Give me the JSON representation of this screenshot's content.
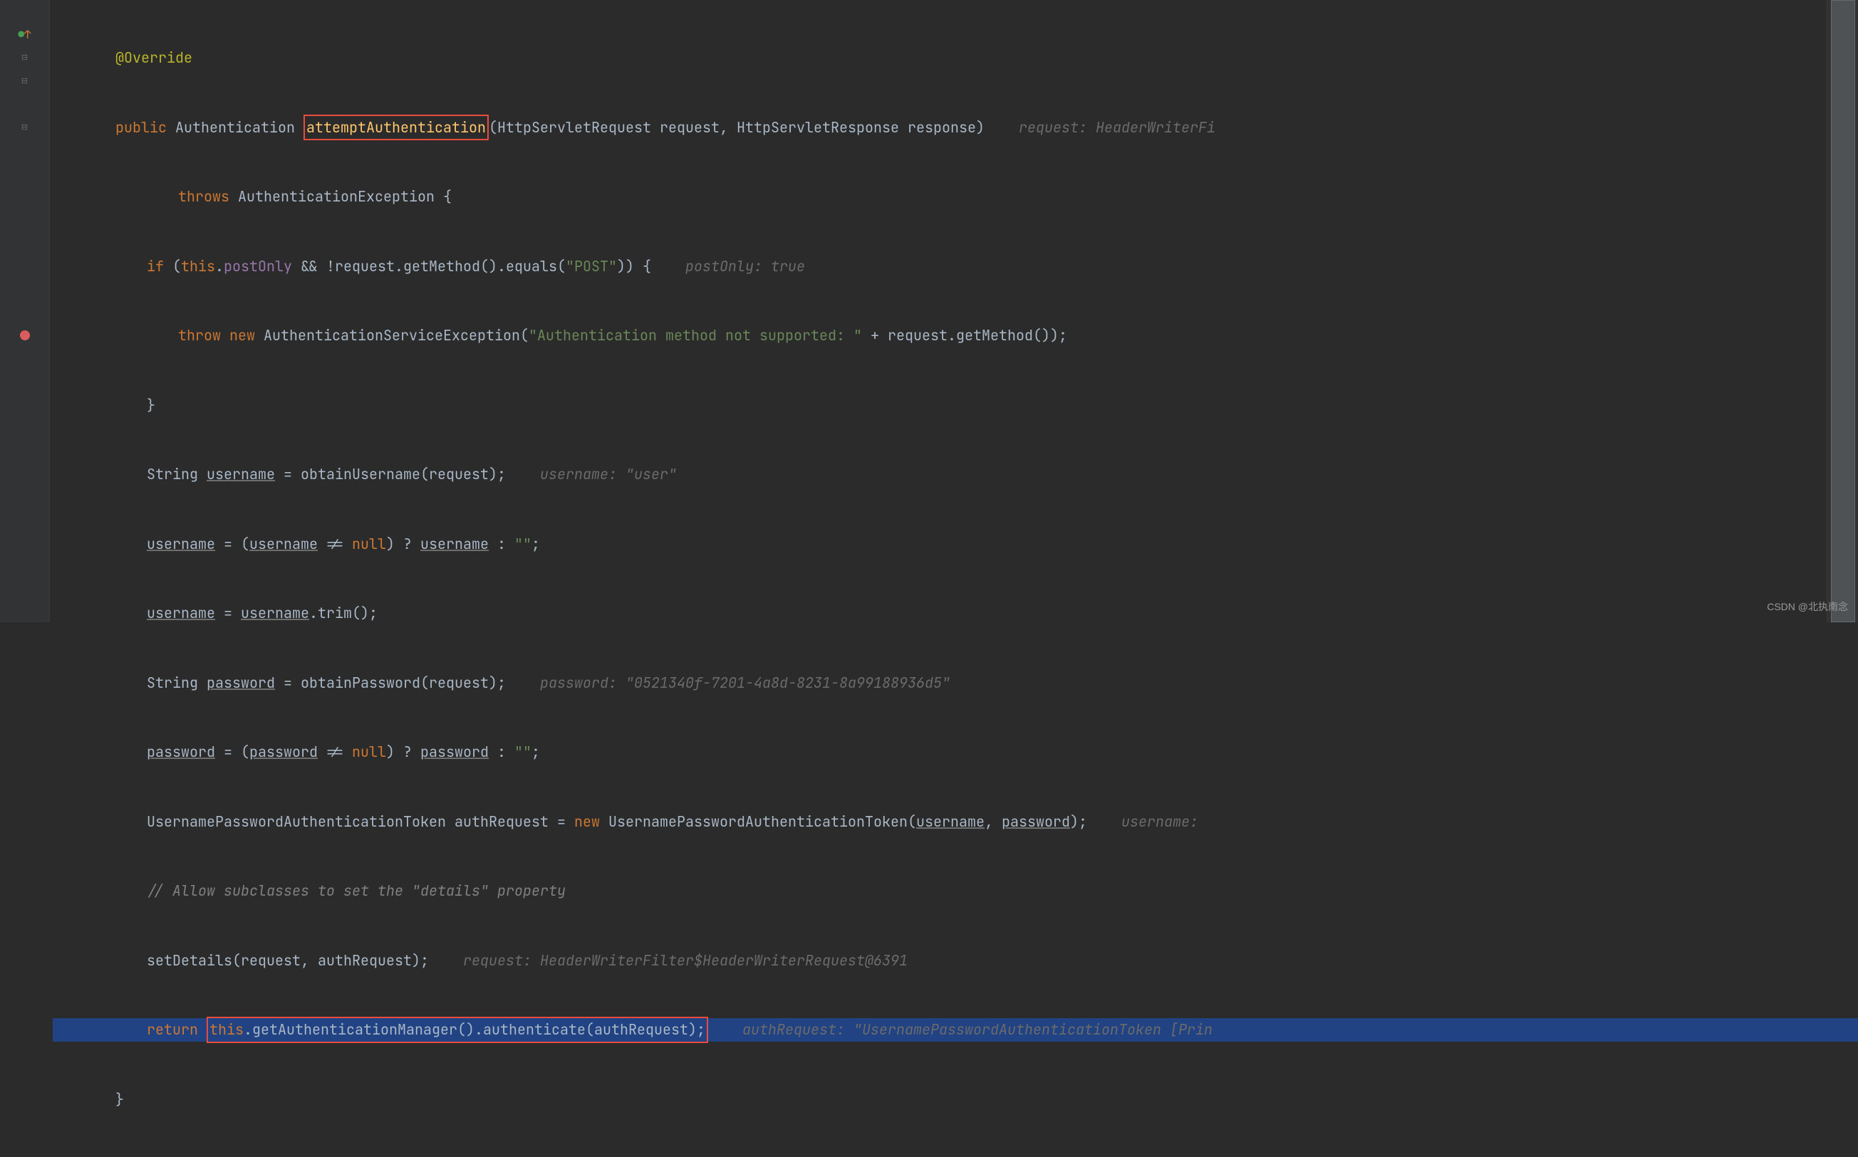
{
  "code": {
    "line1_annotation": "@Override",
    "line2_public": "public",
    "line2_authtype": "Authentication",
    "line2_method": "attemptAuthentication",
    "line2_params": "(HttpServletRequest request, HttpServletResponse response)",
    "line2_hint": "request: HeaderWriterFi",
    "line3_throws": "throws",
    "line3_excep": " AuthenticationException {",
    "line4_if": "if",
    "line4_open": " (",
    "line4_this": "this",
    "line4_dot": ".",
    "line4_postonly": "postOnly",
    "line4_cond": " && !request.getMethod().equals(",
    "line4_post": "\"POST\"",
    "line4_close": ")) {",
    "line4_hint": "postOnly: true",
    "line5_throw": "throw",
    "line5_new": "new",
    "line5_excep": " AuthenticationServiceException(",
    "line5_msg": "\"Authentication method not supported: \"",
    "line5_plus": " + request.getMethod());",
    "line6_brace": "}",
    "line7_a": "String ",
    "line7_var": "username",
    "line7_b": " = obtainUsername(request);",
    "line7_hint": "username: \"user\"",
    "line8_var": "username",
    "line8_a": " = (",
    "line8_var2": "username",
    "line8_b": " != ",
    "line8_null": "null",
    "line8_c": ") ? ",
    "line8_var3": "username",
    "line8_d": " : ",
    "line8_empty": "\"\"",
    "line8_e": ";",
    "line9_var": "username",
    "line9_a": " = ",
    "line9_var2": "username",
    "line9_b": ".trim();",
    "line10_a": "String ",
    "line10_var": "password",
    "line10_b": " = obtainPassword(request);",
    "line10_hint": "password: \"0521340f-7201-4a8d-8231-8a99188936d5\"",
    "line11_var": "password",
    "line11_a": " = (",
    "line11_var2": "password",
    "line11_b": " != ",
    "line11_null": "null",
    "line11_c": ") ? ",
    "line11_var3": "password",
    "line11_d": " : ",
    "line11_empty": "\"\"",
    "line11_e": ";",
    "line12_a": "UsernamePasswordAuthenticationToken authRequest = ",
    "line12_new": "new",
    "line12_b": " UsernamePasswordAuthenticationToken(",
    "line12_var1": "username",
    "line12_c": ", ",
    "line12_var2": "password",
    "line12_d": ");",
    "line12_hint": "username: ",
    "line13_comment": "// Allow subclasses to set the \"details\" property",
    "line14_a": "setDetails(request, authRequest);",
    "line14_hint": "request: HeaderWriterFilter$HeaderWriterRequest@6391",
    "line15_return": "return",
    "line15_this": "this",
    "line15_a": ".getAuthenticationManager().authenticate(authRequest);",
    "line15_hint": "authRequest: \"UsernamePasswordAuthenticationToken [Prin",
    "line16_brace": "}"
  },
  "watermark": "CSDN @北执南念"
}
